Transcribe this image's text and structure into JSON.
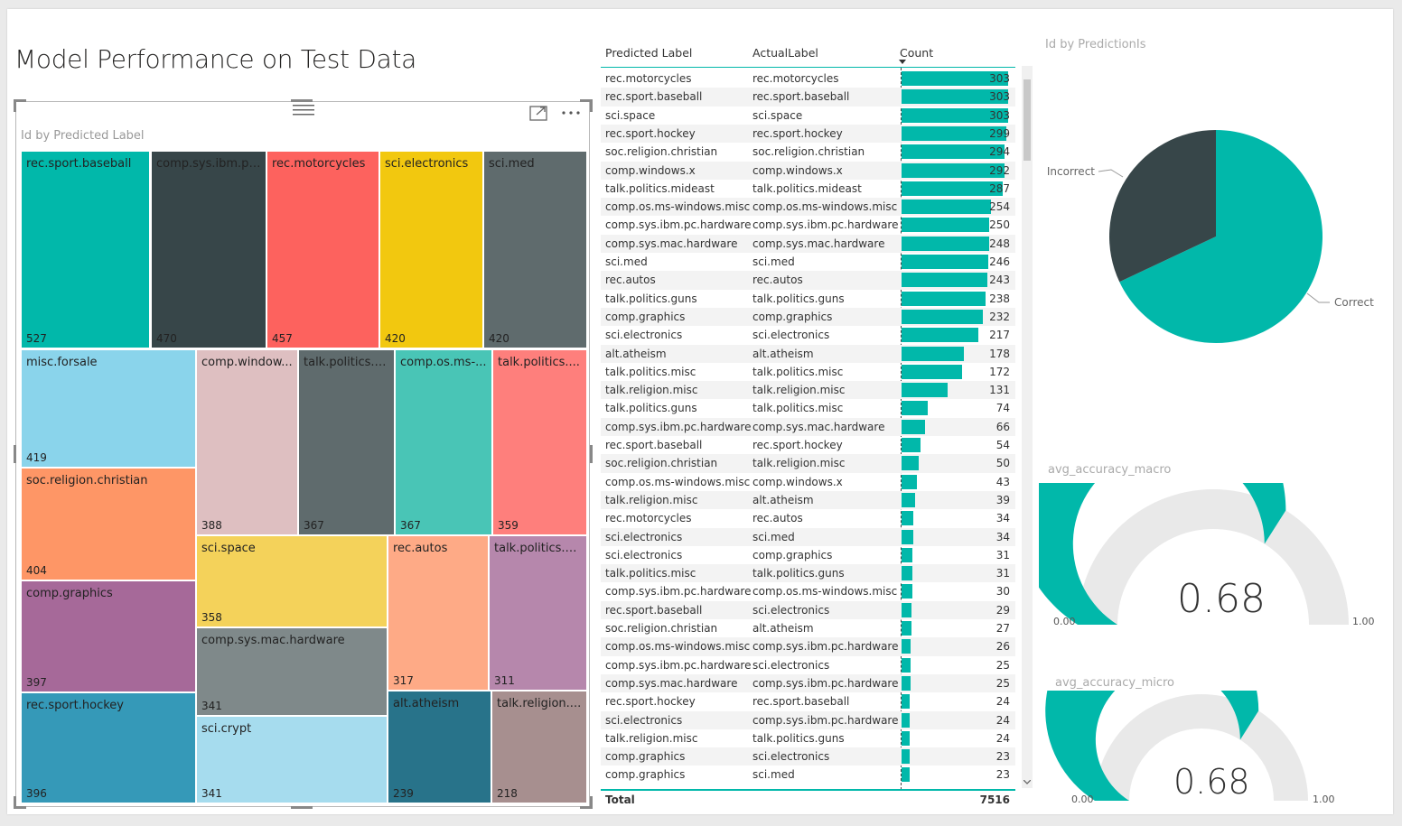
{
  "page": {
    "title": "Model Performance on Test Data"
  },
  "treemap": {
    "title": "Id by Predicted Label",
    "tiles": [
      {
        "label": "rec.sport.baseball",
        "value": "527",
        "color": "#01B8AA"
      },
      {
        "label": "comp.sys.ibm.pc...",
        "value": "470",
        "color": "#374649"
      },
      {
        "label": "rec.motorcycles",
        "value": "457",
        "color": "#FD625E"
      },
      {
        "label": "sci.electronics",
        "value": "420",
        "color": "#F2C80F"
      },
      {
        "label": "sci.med",
        "value": "420",
        "color": "#5F6B6D"
      },
      {
        "label": "misc.forsale",
        "value": "419",
        "color": "#8AD4EB"
      },
      {
        "label": "comp.window...",
        "value": "388",
        "color": "#DEBFC1"
      },
      {
        "label": "talk.politics.g...",
        "value": "367",
        "color": "#5F6B6D"
      },
      {
        "label": "comp.os.ms-...",
        "value": "367",
        "color": "#49C5B6"
      },
      {
        "label": "talk.politics....",
        "value": "359",
        "color": "#FE7F7C"
      },
      {
        "label": "soc.religion.christian",
        "value": "404",
        "color": "#FE9666"
      },
      {
        "label": "sci.space",
        "value": "358",
        "color": "#F4D25A"
      },
      {
        "label": "rec.autos",
        "value": "317",
        "color": "#FEAA86"
      },
      {
        "label": "talk.politics.m...",
        "value": "311",
        "color": "#B687AC"
      },
      {
        "label": "comp.graphics",
        "value": "397",
        "color": "#A66999"
      },
      {
        "label": "comp.sys.mac.hardware",
        "value": "341",
        "color": "#7F898A"
      },
      {
        "label": "rec.sport.hockey",
        "value": "396",
        "color": "#3599B8"
      },
      {
        "label": "sci.crypt",
        "value": "341",
        "color": "#A6DCEE"
      },
      {
        "label": "alt.atheism",
        "value": "239",
        "color": "#28738A"
      },
      {
        "label": "talk.religion....",
        "value": "218",
        "color": "#A78F8F"
      }
    ]
  },
  "table": {
    "headers": [
      "Predicted Label",
      "ActualLabel",
      "Count"
    ],
    "max_count": 303,
    "rows": [
      [
        "rec.motorcycles",
        "rec.motorcycles",
        "303"
      ],
      [
        "rec.sport.baseball",
        "rec.sport.baseball",
        "303"
      ],
      [
        "sci.space",
        "sci.space",
        "303"
      ],
      [
        "rec.sport.hockey",
        "rec.sport.hockey",
        "299"
      ],
      [
        "soc.religion.christian",
        "soc.religion.christian",
        "294"
      ],
      [
        "comp.windows.x",
        "comp.windows.x",
        "292"
      ],
      [
        "talk.politics.mideast",
        "talk.politics.mideast",
        "287"
      ],
      [
        "comp.os.ms-windows.misc",
        "comp.os.ms-windows.misc",
        "254"
      ],
      [
        "comp.sys.ibm.pc.hardware",
        "comp.sys.ibm.pc.hardware",
        "250"
      ],
      [
        "comp.sys.mac.hardware",
        "comp.sys.mac.hardware",
        "248"
      ],
      [
        "sci.med",
        "sci.med",
        "246"
      ],
      [
        "rec.autos",
        "rec.autos",
        "243"
      ],
      [
        "talk.politics.guns",
        "talk.politics.guns",
        "238"
      ],
      [
        "comp.graphics",
        "comp.graphics",
        "232"
      ],
      [
        "sci.electronics",
        "sci.electronics",
        "217"
      ],
      [
        "alt.atheism",
        "alt.atheism",
        "178"
      ],
      [
        "talk.politics.misc",
        "talk.politics.misc",
        "172"
      ],
      [
        "talk.religion.misc",
        "talk.religion.misc",
        "131"
      ],
      [
        "talk.politics.guns",
        "talk.politics.misc",
        "74"
      ],
      [
        "comp.sys.ibm.pc.hardware",
        "comp.sys.mac.hardware",
        "66"
      ],
      [
        "rec.sport.baseball",
        "rec.sport.hockey",
        "54"
      ],
      [
        "soc.religion.christian",
        "talk.religion.misc",
        "50"
      ],
      [
        "comp.os.ms-windows.misc",
        "comp.windows.x",
        "43"
      ],
      [
        "talk.religion.misc",
        "alt.atheism",
        "39"
      ],
      [
        "rec.motorcycles",
        "rec.autos",
        "34"
      ],
      [
        "sci.electronics",
        "sci.med",
        "34"
      ],
      [
        "sci.electronics",
        "comp.graphics",
        "31"
      ],
      [
        "talk.politics.misc",
        "talk.politics.guns",
        "31"
      ],
      [
        "comp.sys.ibm.pc.hardware",
        "comp.os.ms-windows.misc",
        "30"
      ],
      [
        "rec.sport.baseball",
        "sci.electronics",
        "29"
      ],
      [
        "soc.religion.christian",
        "alt.atheism",
        "27"
      ],
      [
        "comp.os.ms-windows.misc",
        "comp.sys.ibm.pc.hardware",
        "26"
      ],
      [
        "comp.sys.ibm.pc.hardware",
        "sci.electronics",
        "25"
      ],
      [
        "comp.sys.mac.hardware",
        "comp.sys.ibm.pc.hardware",
        "25"
      ],
      [
        "rec.sport.hockey",
        "rec.sport.baseball",
        "24"
      ],
      [
        "sci.electronics",
        "comp.sys.ibm.pc.hardware",
        "24"
      ],
      [
        "talk.religion.misc",
        "talk.politics.guns",
        "24"
      ],
      [
        "comp.graphics",
        "sci.electronics",
        "23"
      ],
      [
        "comp.graphics",
        "sci.med",
        "23"
      ]
    ],
    "total_label": "Total",
    "total_value": "7516"
  },
  "pie": {
    "title": "Id by PredictionIs",
    "slices": [
      {
        "label": "Correct",
        "fraction": 0.68,
        "color": "#01B8AA"
      },
      {
        "label": "Incorrect",
        "fraction": 0.32,
        "color": "#374649"
      }
    ]
  },
  "gauges": [
    {
      "title": "avg_accuracy_macro",
      "value": 0.68,
      "value_text": "0.68",
      "min_text": "0.00",
      "max_text": "1.00",
      "fill": "#01B8AA",
      "track": "#E9E9E9"
    },
    {
      "title": "avg_accuracy_micro",
      "value": 0.68,
      "value_text": "0.68",
      "min_text": "0.00",
      "max_text": "1.00",
      "fill": "#01B8AA",
      "track": "#E9E9E9"
    }
  ],
  "icons": [
    "drag-handle-icon",
    "focus-mode-icon",
    "more-options-icon",
    "sort-down-icon",
    "scroll-down-icon"
  ]
}
